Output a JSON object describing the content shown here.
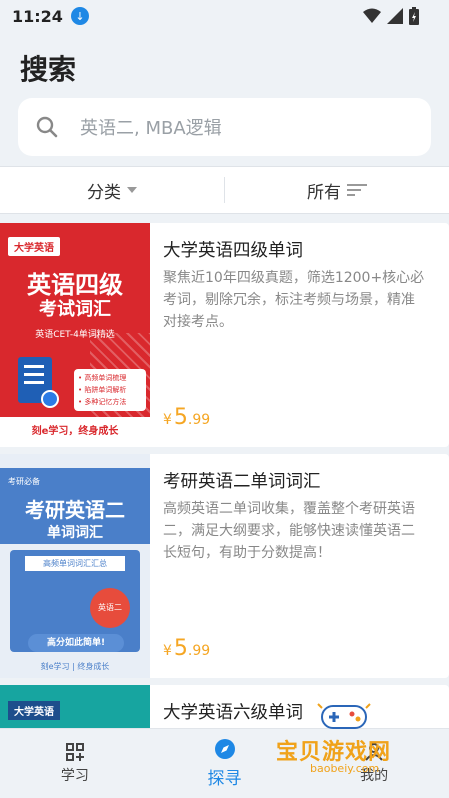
{
  "status": {
    "time": "11:24"
  },
  "page": {
    "title": "搜索"
  },
  "search": {
    "placeholder": "英语二, MBA逻辑"
  },
  "filters": [
    {
      "label": "分类"
    },
    {
      "label": "所有"
    }
  ],
  "books": [
    {
      "title": "大学英语四级单词",
      "desc": "聚焦近10年四级真题，筛选1200+核心必考词，剔除冗余，标注考频与场景，精准对接考点。",
      "currency": "¥",
      "price_int": "5",
      "price_dec": ".99",
      "cover": {
        "tag": "大学英语",
        "line1": "英语四级",
        "line2": "考试词汇",
        "sub": "英语CET-4单词精选",
        "bullets": [
          "• 高频单词梳理",
          "• 陷阱单词解析",
          "• 多种记忆方法"
        ],
        "footer": "刻e学习，终身成长"
      }
    },
    {
      "title": "考研英语二单词词汇",
      "desc": "高频英语二单词收集，覆盖整个考研英语二，满足大纲要求，能够快速读懂英语二长短句，有助于分数提高！",
      "currency": "¥",
      "price_int": "5",
      "price_dec": ".99",
      "cover": {
        "tag": "考研必备",
        "line1": "考研英语二",
        "line2": "单词词汇",
        "sub": "高频单词词汇汇总",
        "badge": "英语二",
        "pill": "高分如此简单!",
        "footer": "刻e学习 | 终身成长"
      }
    },
    {
      "title": "大学英语六级单词",
      "cover": {
        "tag": "大学英语"
      }
    }
  ],
  "tabs": [
    {
      "label": "学习",
      "icon": "grid-icon"
    },
    {
      "label": "探寻",
      "icon": "compass-icon"
    },
    {
      "label": "我的",
      "icon": "user-icon"
    }
  ],
  "watermark": {
    "text": "宝贝游戏网",
    "url": "baobeiy.com"
  },
  "colors": {
    "accent": "#1e88e5",
    "price": "#f5a623",
    "cover_red": "#d9282d",
    "cover_blue": "#4a7fc9",
    "cover_teal": "#17a5a0"
  }
}
